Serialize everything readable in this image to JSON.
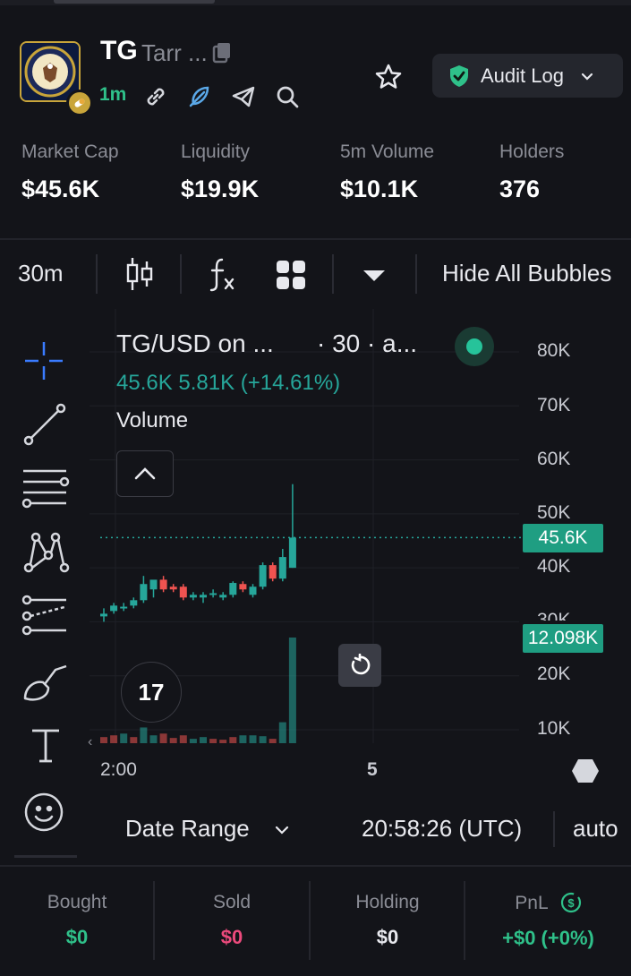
{
  "token": {
    "ticker": "TG",
    "name": "Tarr ...",
    "age": "1m"
  },
  "header": {
    "audit_label": "Audit Log"
  },
  "stats": [
    {
      "label": "Market Cap",
      "value": "$45.6K"
    },
    {
      "label": "Liquidity",
      "value": "$19.9K"
    },
    {
      "label": "5m Volume",
      "value": "$10.1K"
    },
    {
      "label": "Holders",
      "value": "376"
    }
  ],
  "toolbar": {
    "interval": "30m",
    "hide_bubbles": "Hide All Bubbles"
  },
  "chart": {
    "symbol": "TG/USD on ...",
    "meta": "· 30 · a...",
    "ohlc": "45.6K  5.81K (+14.61%)",
    "volume_label": "Volume",
    "y_ticks": [
      "80K",
      "70K",
      "60K",
      "50K",
      "40K",
      "30K",
      "20K",
      "10K"
    ],
    "price_tag": "45.6K",
    "volume_tag": "12.098K",
    "x_ticks": [
      "2:00",
      "5"
    ],
    "tv_logo": "17",
    "up_color": "#26a69a",
    "down_color": "#ef5350"
  },
  "chart_data": {
    "type": "candlestick",
    "ylim": [
      0,
      85000
    ],
    "last_price": 45600,
    "last_volume": 12098,
    "candles": [
      {
        "o": 31000,
        "h": 32500,
        "l": 30000,
        "c": 31500
      },
      {
        "o": 32000,
        "h": 33500,
        "l": 31500,
        "c": 33000
      },
      {
        "o": 32500,
        "h": 33500,
        "l": 32000,
        "c": 32800
      },
      {
        "o": 33000,
        "h": 34500,
        "l": 32500,
        "c": 34000
      },
      {
        "o": 34000,
        "h": 38500,
        "l": 33500,
        "c": 37000
      },
      {
        "o": 36000,
        "h": 37500,
        "l": 34500,
        "c": 37800
      },
      {
        "o": 37800,
        "h": 38500,
        "l": 35500,
        "c": 36000
      },
      {
        "o": 36500,
        "h": 37000,
        "l": 35500,
        "c": 36000
      },
      {
        "o": 36500,
        "h": 37000,
        "l": 34000,
        "c": 34500
      },
      {
        "o": 34500,
        "h": 35500,
        "l": 34000,
        "c": 35000
      },
      {
        "o": 34500,
        "h": 35500,
        "l": 33500,
        "c": 35000
      },
      {
        "o": 35000,
        "h": 36000,
        "l": 34500,
        "c": 35300
      },
      {
        "o": 34500,
        "h": 35500,
        "l": 34000,
        "c": 35000
      },
      {
        "o": 35000,
        "h": 37500,
        "l": 34500,
        "c": 37200
      },
      {
        "o": 37000,
        "h": 37500,
        "l": 35500,
        "c": 36000
      },
      {
        "o": 35000,
        "h": 37000,
        "l": 34500,
        "c": 36500
      },
      {
        "o": 36500,
        "h": 41000,
        "l": 36000,
        "c": 40500
      },
      {
        "o": 40500,
        "h": 41000,
        "l": 37500,
        "c": 38000
      },
      {
        "o": 38000,
        "h": 43500,
        "l": 37500,
        "c": 42000
      },
      {
        "o": 40000,
        "h": 55500,
        "l": 40000,
        "c": 45600
      }
    ],
    "volumes": [
      {
        "v": 700,
        "up": false
      },
      {
        "v": 900,
        "up": false
      },
      {
        "v": 1100,
        "up": true
      },
      {
        "v": 700,
        "up": false
      },
      {
        "v": 1800,
        "up": true
      },
      {
        "v": 900,
        "up": true
      },
      {
        "v": 1100,
        "up": false
      },
      {
        "v": 600,
        "up": false
      },
      {
        "v": 900,
        "up": false
      },
      {
        "v": 500,
        "up": true
      },
      {
        "v": 700,
        "up": true
      },
      {
        "v": 500,
        "up": false
      },
      {
        "v": 400,
        "up": false
      },
      {
        "v": 700,
        "up": false
      },
      {
        "v": 900,
        "up": true
      },
      {
        "v": 900,
        "up": true
      },
      {
        "v": 800,
        "up": true
      },
      {
        "v": 500,
        "up": false
      },
      {
        "v": 2400,
        "up": true
      },
      {
        "v": 12098,
        "up": true
      }
    ]
  },
  "bottom": {
    "date_range": "Date Range",
    "time": "20:58:26 (UTC)",
    "mode": "auto"
  },
  "footer": [
    {
      "label": "Bought",
      "value": "$0",
      "color": "#2fc18a"
    },
    {
      "label": "Sold",
      "value": "$0",
      "color": "#ec4a7c"
    },
    {
      "label": "Holding",
      "value": "$0",
      "color": "#e8e9ee"
    },
    {
      "label": "PnL",
      "value": "+$0 (+0%)",
      "color": "#2fc18a"
    }
  ]
}
